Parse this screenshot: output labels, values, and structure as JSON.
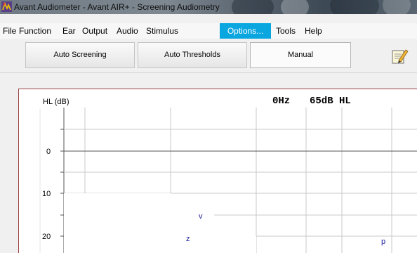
{
  "window": {
    "title": "Avant Audiometer - Avant AIR+ - Screening Audiometry",
    "icon": "audiometer-app-icon"
  },
  "menu": {
    "items": [
      {
        "label": "File"
      },
      {
        "label": "Function"
      },
      {
        "label": "Ear"
      },
      {
        "label": "Output"
      },
      {
        "label": "Audio"
      },
      {
        "label": "Stimulus"
      },
      {
        "label": "Options...",
        "selected": true
      },
      {
        "label": "Tools"
      },
      {
        "label": "Help"
      }
    ]
  },
  "toolbar": {
    "auto_screening": "Auto Screening",
    "auto_thresholds": "Auto Thresholds",
    "manual": "Manual",
    "active_mode": "Manual",
    "edit_icon": "notepad-pencil-icon"
  },
  "readout": {
    "frequency": "0Hz",
    "level": "65dB HL"
  },
  "chart_data": {
    "type": "audiogram",
    "ylabel": "HL (dB)",
    "y_ticks": [
      "0",
      "10",
      "20"
    ],
    "y_reversed": true,
    "grid": true,
    "markers": [
      {
        "symbol": "v",
        "y_db": 17
      },
      {
        "symbol": "z",
        "y_db": 22
      },
      {
        "symbol": "p",
        "y_db": 23
      }
    ]
  },
  "colors": {
    "menu_highlight": "#0aa6e0",
    "panel_border": "#9a4040",
    "marker": "#1a1a9c"
  }
}
